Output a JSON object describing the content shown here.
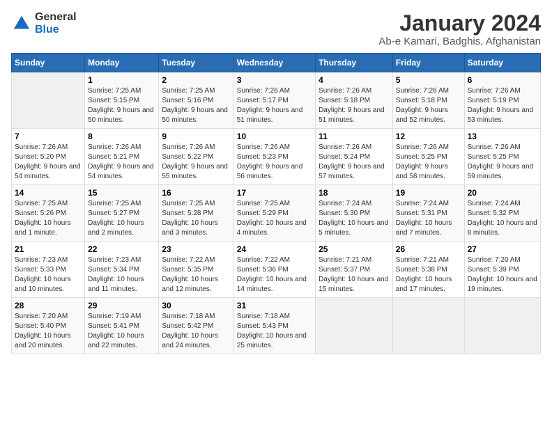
{
  "logo": {
    "general": "General",
    "blue": "Blue"
  },
  "title": "January 2024",
  "subtitle": "Ab-e Kamari, Badghis, Afghanistan",
  "days_of_week": [
    "Sunday",
    "Monday",
    "Tuesday",
    "Wednesday",
    "Thursday",
    "Friday",
    "Saturday"
  ],
  "weeks": [
    [
      {
        "day": "",
        "sunrise": "",
        "sunset": "",
        "daylight": "",
        "empty": true
      },
      {
        "day": "1",
        "sunrise": "Sunrise: 7:25 AM",
        "sunset": "Sunset: 5:15 PM",
        "daylight": "Daylight: 9 hours and 50 minutes."
      },
      {
        "day": "2",
        "sunrise": "Sunrise: 7:25 AM",
        "sunset": "Sunset: 5:16 PM",
        "daylight": "Daylight: 9 hours and 50 minutes."
      },
      {
        "day": "3",
        "sunrise": "Sunrise: 7:26 AM",
        "sunset": "Sunset: 5:17 PM",
        "daylight": "Daylight: 9 hours and 51 minutes."
      },
      {
        "day": "4",
        "sunrise": "Sunrise: 7:26 AM",
        "sunset": "Sunset: 5:18 PM",
        "daylight": "Daylight: 9 hours and 51 minutes."
      },
      {
        "day": "5",
        "sunrise": "Sunrise: 7:26 AM",
        "sunset": "Sunset: 5:18 PM",
        "daylight": "Daylight: 9 hours and 52 minutes."
      },
      {
        "day": "6",
        "sunrise": "Sunrise: 7:26 AM",
        "sunset": "Sunset: 5:19 PM",
        "daylight": "Daylight: 9 hours and 53 minutes."
      }
    ],
    [
      {
        "day": "7",
        "sunrise": "Sunrise: 7:26 AM",
        "sunset": "Sunset: 5:20 PM",
        "daylight": "Daylight: 9 hours and 54 minutes."
      },
      {
        "day": "8",
        "sunrise": "Sunrise: 7:26 AM",
        "sunset": "Sunset: 5:21 PM",
        "daylight": "Daylight: 9 hours and 54 minutes."
      },
      {
        "day": "9",
        "sunrise": "Sunrise: 7:26 AM",
        "sunset": "Sunset: 5:22 PM",
        "daylight": "Daylight: 9 hours and 55 minutes."
      },
      {
        "day": "10",
        "sunrise": "Sunrise: 7:26 AM",
        "sunset": "Sunset: 5:23 PM",
        "daylight": "Daylight: 9 hours and 56 minutes."
      },
      {
        "day": "11",
        "sunrise": "Sunrise: 7:26 AM",
        "sunset": "Sunset: 5:24 PM",
        "daylight": "Daylight: 9 hours and 57 minutes."
      },
      {
        "day": "12",
        "sunrise": "Sunrise: 7:26 AM",
        "sunset": "Sunset: 5:25 PM",
        "daylight": "Daylight: 9 hours and 58 minutes."
      },
      {
        "day": "13",
        "sunrise": "Sunrise: 7:26 AM",
        "sunset": "Sunset: 5:25 PM",
        "daylight": "Daylight: 9 hours and 59 minutes."
      }
    ],
    [
      {
        "day": "14",
        "sunrise": "Sunrise: 7:25 AM",
        "sunset": "Sunset: 5:26 PM",
        "daylight": "Daylight: 10 hours and 1 minute."
      },
      {
        "day": "15",
        "sunrise": "Sunrise: 7:25 AM",
        "sunset": "Sunset: 5:27 PM",
        "daylight": "Daylight: 10 hours and 2 minutes."
      },
      {
        "day": "16",
        "sunrise": "Sunrise: 7:25 AM",
        "sunset": "Sunset: 5:28 PM",
        "daylight": "Daylight: 10 hours and 3 minutes."
      },
      {
        "day": "17",
        "sunrise": "Sunrise: 7:25 AM",
        "sunset": "Sunset: 5:29 PM",
        "daylight": "Daylight: 10 hours and 4 minutes."
      },
      {
        "day": "18",
        "sunrise": "Sunrise: 7:24 AM",
        "sunset": "Sunset: 5:30 PM",
        "daylight": "Daylight: 10 hours and 5 minutes."
      },
      {
        "day": "19",
        "sunrise": "Sunrise: 7:24 AM",
        "sunset": "Sunset: 5:31 PM",
        "daylight": "Daylight: 10 hours and 7 minutes."
      },
      {
        "day": "20",
        "sunrise": "Sunrise: 7:24 AM",
        "sunset": "Sunset: 5:32 PM",
        "daylight": "Daylight: 10 hours and 8 minutes."
      }
    ],
    [
      {
        "day": "21",
        "sunrise": "Sunrise: 7:23 AM",
        "sunset": "Sunset: 5:33 PM",
        "daylight": "Daylight: 10 hours and 10 minutes."
      },
      {
        "day": "22",
        "sunrise": "Sunrise: 7:23 AM",
        "sunset": "Sunset: 5:34 PM",
        "daylight": "Daylight: 10 hours and 11 minutes."
      },
      {
        "day": "23",
        "sunrise": "Sunrise: 7:22 AM",
        "sunset": "Sunset: 5:35 PM",
        "daylight": "Daylight: 10 hours and 12 minutes."
      },
      {
        "day": "24",
        "sunrise": "Sunrise: 7:22 AM",
        "sunset": "Sunset: 5:36 PM",
        "daylight": "Daylight: 10 hours and 14 minutes."
      },
      {
        "day": "25",
        "sunrise": "Sunrise: 7:21 AM",
        "sunset": "Sunset: 5:37 PM",
        "daylight": "Daylight: 10 hours and 15 minutes."
      },
      {
        "day": "26",
        "sunrise": "Sunrise: 7:21 AM",
        "sunset": "Sunset: 5:38 PM",
        "daylight": "Daylight: 10 hours and 17 minutes."
      },
      {
        "day": "27",
        "sunrise": "Sunrise: 7:20 AM",
        "sunset": "Sunset: 5:39 PM",
        "daylight": "Daylight: 10 hours and 19 minutes."
      }
    ],
    [
      {
        "day": "28",
        "sunrise": "Sunrise: 7:20 AM",
        "sunset": "Sunset: 5:40 PM",
        "daylight": "Daylight: 10 hours and 20 minutes."
      },
      {
        "day": "29",
        "sunrise": "Sunrise: 7:19 AM",
        "sunset": "Sunset: 5:41 PM",
        "daylight": "Daylight: 10 hours and 22 minutes."
      },
      {
        "day": "30",
        "sunrise": "Sunrise: 7:18 AM",
        "sunset": "Sunset: 5:42 PM",
        "daylight": "Daylight: 10 hours and 24 minutes."
      },
      {
        "day": "31",
        "sunrise": "Sunrise: 7:18 AM",
        "sunset": "Sunset: 5:43 PM",
        "daylight": "Daylight: 10 hours and 25 minutes."
      },
      {
        "day": "",
        "sunrise": "",
        "sunset": "",
        "daylight": "",
        "empty": true
      },
      {
        "day": "",
        "sunrise": "",
        "sunset": "",
        "daylight": "",
        "empty": true
      },
      {
        "day": "",
        "sunrise": "",
        "sunset": "",
        "daylight": "",
        "empty": true
      }
    ]
  ]
}
